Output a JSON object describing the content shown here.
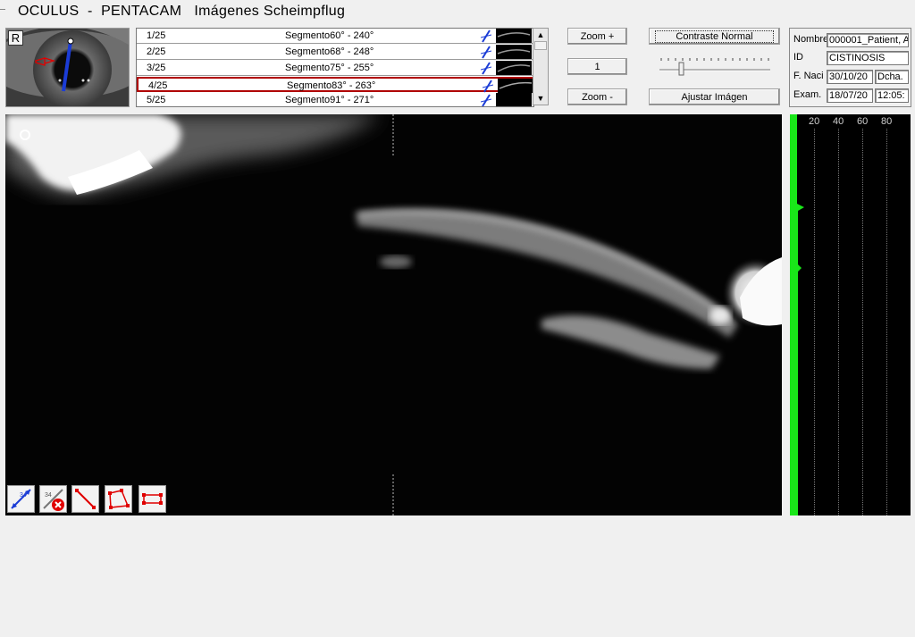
{
  "app": {
    "title": "OCULUS  -  PENTACAM   Imágenes Scheimpflug"
  },
  "eye_thumbnail": {
    "eye_side": "R"
  },
  "segments": [
    {
      "index": "1/25",
      "label": "Segmento60° - 240°"
    },
    {
      "index": "2/25",
      "label": "Segmento68° - 248°"
    },
    {
      "index": "3/25",
      "label": "Segmento75° - 255°"
    },
    {
      "index": "4/25",
      "label": "Segmento83° - 263°"
    },
    {
      "index": "5/25",
      "label": "Segmento91° - 271°"
    }
  ],
  "selected_segment": "4/25",
  "zoom": {
    "plus_label": "Zoom +",
    "level": "1",
    "minus_label": "Zoom -"
  },
  "contrast": {
    "label": "Contraste Normal",
    "adjust_label": "Ajustar Imágen"
  },
  "patient": {
    "name_label": "Nombre",
    "name_value": "000001_Patient, A",
    "id_label": "ID",
    "id_value": "CISTINOSIS",
    "dob_label": "F. Naci",
    "dob_value": "30/10/20",
    "eye_value": "Dcha.",
    "exam_label": "Exam.",
    "exam_date": "18/07/20",
    "exam_time": "12:05:"
  },
  "density_axis": {
    "ticks": [
      "20",
      "40",
      "60",
      "80"
    ]
  },
  "tools": [
    "measure-distance-icon",
    "delete-measure-icon",
    "line-tool-icon",
    "polygon-tool-icon",
    "rectangle-tool-icon"
  ],
  "colors": {
    "selection": "#b00000",
    "density": "#19e619",
    "measure_line": "#1b3cd6",
    "tool_red": "#e00000"
  }
}
